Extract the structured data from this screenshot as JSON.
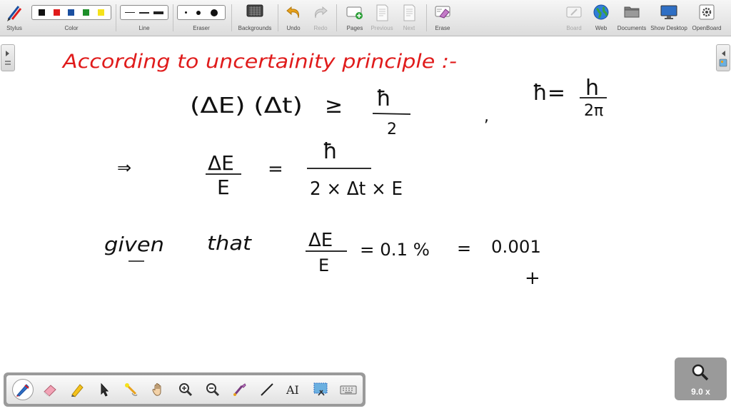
{
  "toolbar": {
    "stylus": "Stylus",
    "color": "Color",
    "line": "Line",
    "eraser": "Eraser",
    "backgrounds": "Backgrounds",
    "undo": "Undo",
    "redo": "Redo",
    "pages": "Pages",
    "previous": "Previous",
    "next": "Next",
    "erase": "Erase",
    "board": "Board",
    "web": "Web",
    "documents": "Documents",
    "show_desktop": "Show Desktop",
    "openboard": "OpenBoard"
  },
  "palette_colors": [
    "#111111",
    "#e01b1b",
    "#1b4fa0",
    "#1e8f2a",
    "#f5e21b"
  ],
  "dock_tools": [
    "pen-icon",
    "eraser-icon",
    "highlighter-icon",
    "pointer-arrow-icon",
    "laser-pointer-icon",
    "hand-icon",
    "zoom-in-icon",
    "zoom-out-icon",
    "capture-icon",
    "line-icon",
    "text-icon",
    "screen-capture-icon",
    "keyboard-icon"
  ],
  "zoom_level": "9.0 x",
  "whiteboard": {
    "heading": "According to uncertainity principle :-",
    "ineq_lhs": "(ΔE) (Δt)",
    "ineq_op": "≥",
    "hbar": "ħ",
    "two": "2",
    "comma": ",",
    "hbar_def_lhs": "ħ=",
    "h": "h",
    "two_pi": "2π",
    "implies": "⇒",
    "ratio_num": "ΔE",
    "ratio_den": "E",
    "eq": "=",
    "rhs_den": "2 × Δt × E",
    "given": "given",
    "that": "that",
    "given_num": "ΔE",
    "given_den": "E",
    "given_val": "= 0.1 %",
    "eq2": "=",
    "given_dec": "0.001",
    "cursor": "+"
  },
  "colors": {
    "heading_ink": "#e01b1b",
    "ink": "#111111"
  }
}
